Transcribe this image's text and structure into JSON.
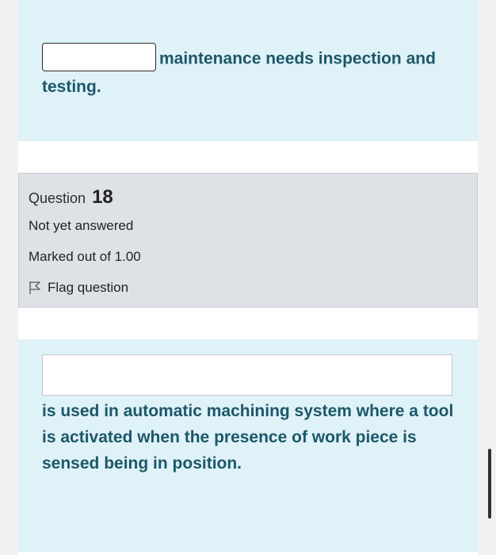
{
  "q17": {
    "answer_value": "",
    "text_after_blank": "maintenance needs inspection and testing."
  },
  "q18": {
    "info": {
      "question_label": "Question",
      "question_number": "18",
      "state": "Not yet answered",
      "grade": "Marked out of 1.00",
      "flag_label": "Flag question"
    },
    "answer_value": "",
    "text": "is used in automatic machining system where a tool is activated when the presence of work piece is sensed being in position."
  },
  "colors": {
    "question_text": "#1d5769",
    "content_bg": "#def2f8",
    "info_bg": "#dee2e6"
  },
  "icons": {
    "flag": "flag-icon"
  }
}
